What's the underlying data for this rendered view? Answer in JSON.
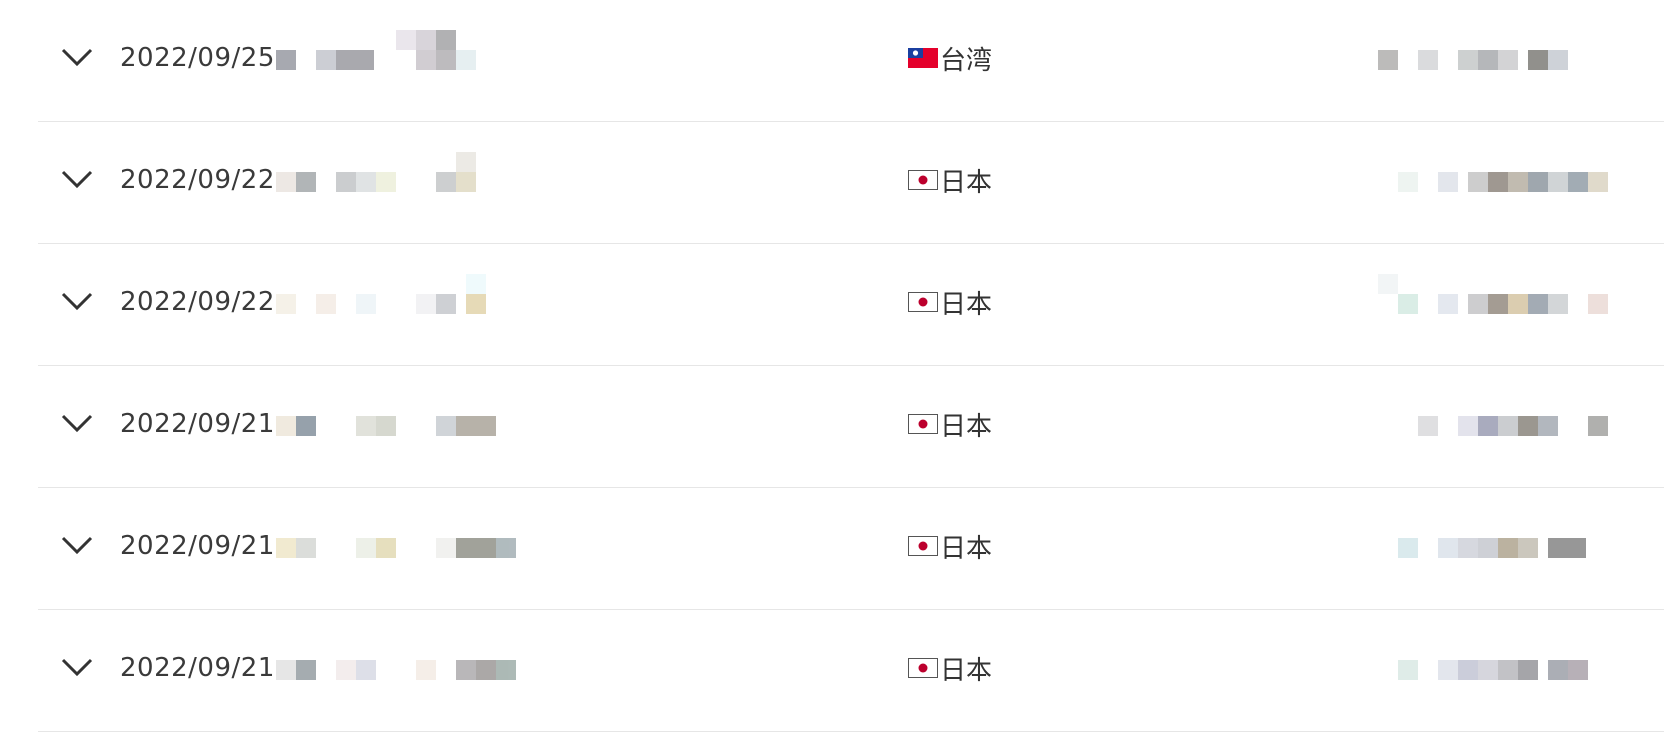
{
  "records": [
    {
      "date": "2022/09/25",
      "country": "台湾",
      "flag": "taiwan-flag-icon"
    },
    {
      "date": "2022/09/22",
      "country": "日本",
      "flag": "japan-flag-icon"
    },
    {
      "date": "2022/09/22",
      "country": "日本",
      "flag": "japan-flag-icon"
    },
    {
      "date": "2022/09/21",
      "country": "日本",
      "flag": "japan-flag-icon"
    },
    {
      "date": "2022/09/21",
      "country": "日本",
      "flag": "japan-flag-icon"
    },
    {
      "date": "2022/09/21",
      "country": "日本",
      "flag": "japan-flag-icon"
    }
  ],
  "icons": {
    "expand": "chevron-down-icon"
  },
  "colors": {
    "text": "#333333",
    "divider": "#e6e6e6",
    "taiwan_red": "#e4002b",
    "taiwan_blue": "#1b3fa0",
    "japan_red": "#bc002d"
  }
}
